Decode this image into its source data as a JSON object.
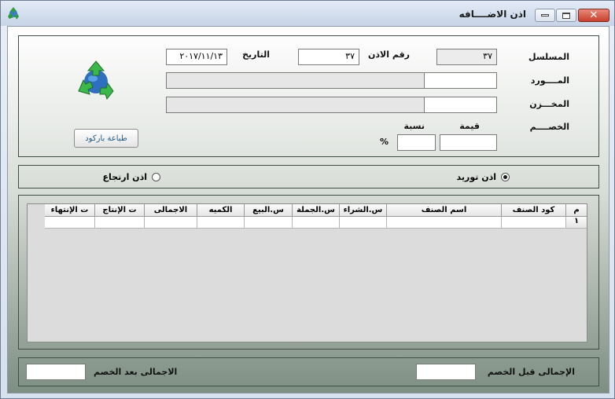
{
  "window": {
    "title": "اذن الاضــــافه"
  },
  "form": {
    "serial_label": "المسلسل",
    "serial_value": "٣٧",
    "permit_no_label": "رقم الاذن",
    "permit_no_value": "٣٧",
    "date_label": "التاريخ",
    "date_value": "٢٠١٧/١١/١٣",
    "supplier_label": "المــــورد",
    "supplier_code": "",
    "supplier_name": "",
    "store_label": "المخـــزن",
    "store_code": "",
    "store_name": "",
    "discount_label": "الخصــــم",
    "discount_value_label": "قيمة",
    "discount_value": "",
    "discount_pct_label": "نسبة",
    "discount_pct": "",
    "percent_sign": "%",
    "barcode_button": "طباعة باركود",
    "logo_icon": "recycle-globe-icon"
  },
  "permit_type": {
    "supply_label": "اذن توريد",
    "supply_selected": true,
    "return_label": "اذن ارتجاع",
    "return_selected": false
  },
  "grid": {
    "columns": [
      "م",
      "كود الصنف",
      "اسم الصنف",
      "س.الشراء",
      "س.الجملة",
      "س.البيع",
      "الكميه",
      "الاجمالى",
      "ت الإنتاج",
      "ت الإنتهاء"
    ],
    "rows": [
      [
        "١",
        "",
        "",
        "",
        "",
        "",
        "",
        "",
        "",
        ""
      ]
    ]
  },
  "totals": {
    "before_discount_label": "الإجمالى قبل الخصم",
    "before_discount_value": "",
    "after_discount_label": "الاجمالى بعد الخصم",
    "after_discount_value": ""
  },
  "colors": {
    "close_button": "#c7402c",
    "panel_border": "#3f4d44",
    "gradient_bottom": "#7d8e82"
  }
}
